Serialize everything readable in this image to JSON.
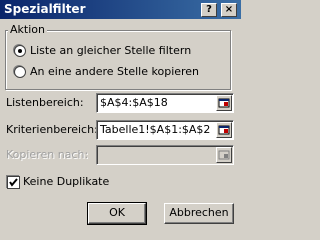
{
  "window": {
    "title": "Spezialfilter",
    "help_glyph": "?",
    "close_glyph": "×"
  },
  "action": {
    "legend": "Aktion",
    "options": [
      {
        "label": "Liste an gleicher Stelle filtern",
        "selected": true
      },
      {
        "label": "An eine andere Stelle kopieren",
        "selected": false
      }
    ]
  },
  "fields": {
    "list_range": {
      "label": "Listenbereich:",
      "value": "$A$4:$A$18"
    },
    "criteria_range": {
      "label": "Kriterienbereich:",
      "value": "Tabelle1!$A$1:$A$2"
    },
    "copy_to": {
      "label": "Kopieren nach:",
      "value": "",
      "disabled": true
    }
  },
  "unique": {
    "label": "Keine Duplikate",
    "checked": true
  },
  "buttons": {
    "ok": "OK",
    "cancel": "Abbrechen"
  },
  "colors": {
    "title_bar": "#0a246a",
    "face": "#d4d0c8"
  }
}
